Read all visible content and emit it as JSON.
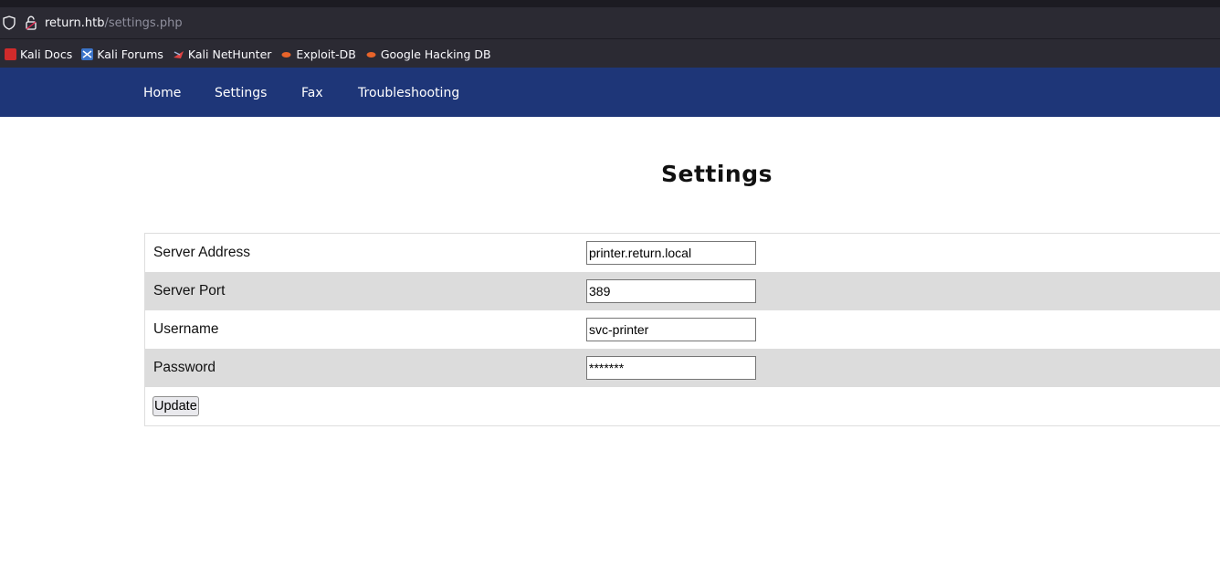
{
  "browser": {
    "url_host": "return.htb",
    "url_path": "/settings.php",
    "bookmarks": [
      {
        "label": "Kali Docs",
        "icon": "kali-docs-icon"
      },
      {
        "label": "Kali Forums",
        "icon": "kali-forums-icon"
      },
      {
        "label": "Kali NetHunter",
        "icon": "kali-nethunter-icon"
      },
      {
        "label": "Exploit-DB",
        "icon": "exploit-db-icon"
      },
      {
        "label": "Google Hacking DB",
        "icon": "ghdb-icon"
      }
    ]
  },
  "nav": {
    "items": [
      "Home",
      "Settings",
      "Fax",
      "Troubleshooting"
    ]
  },
  "page": {
    "title": "Settings"
  },
  "form": {
    "rows": [
      {
        "label": "Server Address",
        "value": "printer.return.local"
      },
      {
        "label": "Server Port",
        "value": "389"
      },
      {
        "label": "Username",
        "value": "svc-printer"
      },
      {
        "label": "Password",
        "value": "*******"
      }
    ],
    "submit_label": "Update"
  },
  "colors": {
    "nav_bg": "#1e3678",
    "browser_bg": "#2b2a33",
    "alt_row": "#dcdcdc"
  }
}
